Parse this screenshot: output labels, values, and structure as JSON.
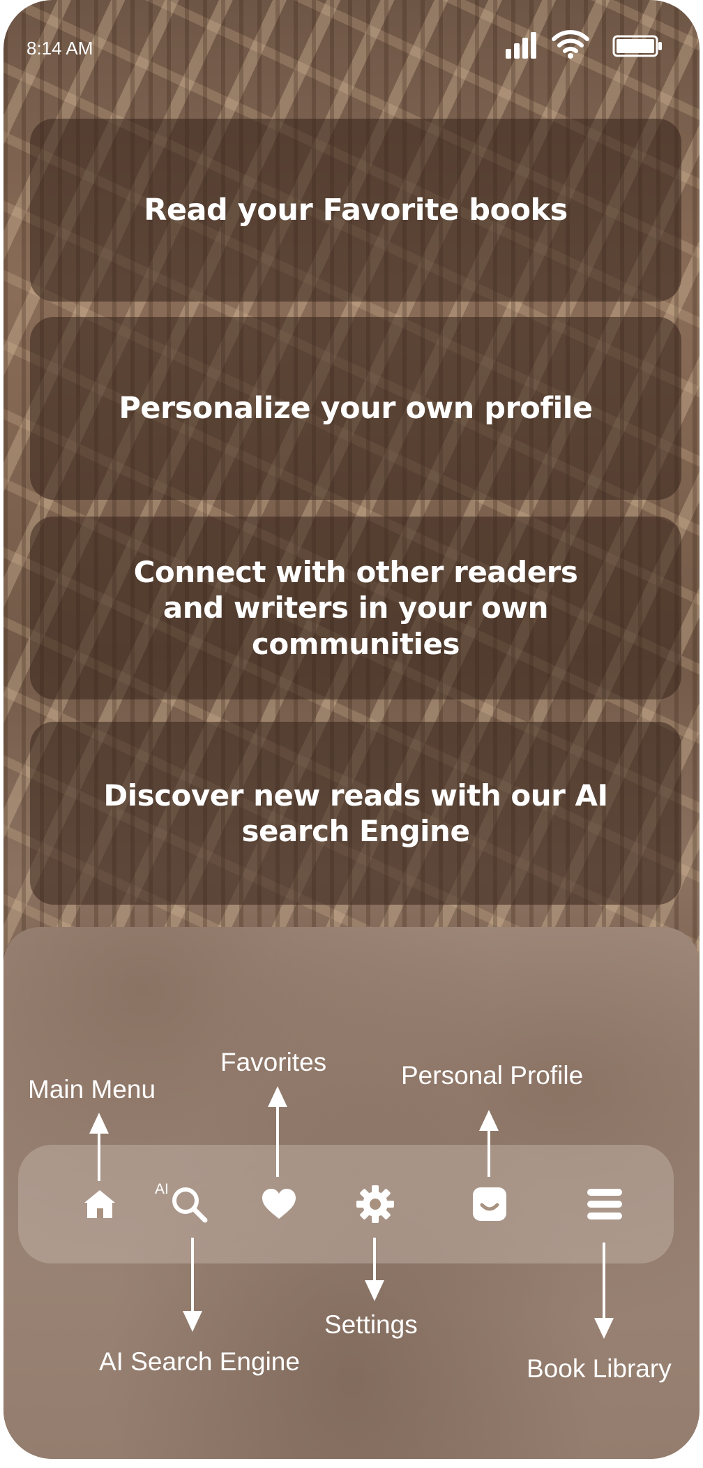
{
  "status_bar": {
    "time": "8:14 AM"
  },
  "cards": [
    {
      "text": "Read your Favorite books"
    },
    {
      "text": "Personalize your own profile"
    },
    {
      "text": "Connect with other readers and writers in your own communities"
    },
    {
      "text": "Discover new reads with our AI search Engine"
    }
  ],
  "nav": {
    "ai_badge": "AI",
    "icons": [
      "home-icon",
      "ai-search-icon",
      "heart-icon",
      "gear-icon",
      "smile-face-icon",
      "menu-lines-icon"
    ]
  },
  "annotations": {
    "main_menu": "Main Menu",
    "favorites": "Favorites",
    "personal_profile": "Personal Profile",
    "ai_search_engine": "AI Search Engine",
    "settings": "Settings",
    "book_library": "Book Library"
  },
  "colors": {
    "text": "#ffffff",
    "card_bg": "#37241c"
  }
}
